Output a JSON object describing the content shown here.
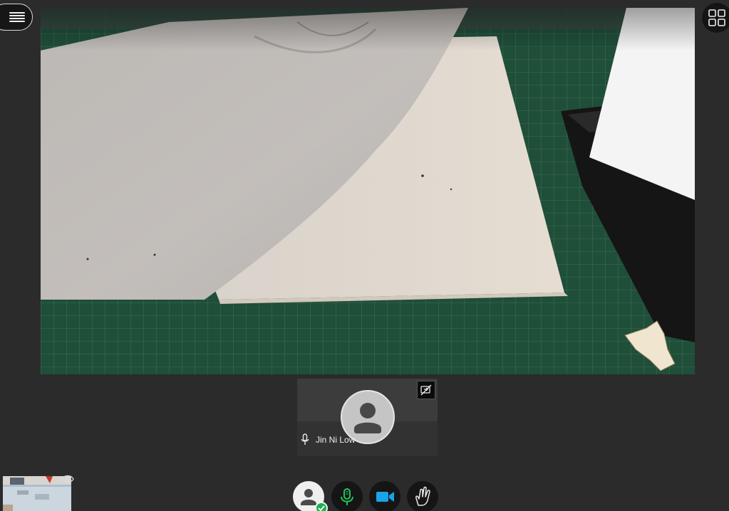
{
  "app": {
    "theme_background": "#2b2b2b",
    "accent_green": "#18b24a",
    "accent_blue": "#1aa3e8"
  },
  "toolbar": {
    "menu_icon": "hamburger-menu-icon",
    "grid_view_icon": "grid-view-icon"
  },
  "main_video": {
    "content_icon": "camera-feed"
  },
  "participant": {
    "name": "Jin Ni Low",
    "avatar_icon": "user-silhouette-icon",
    "mic_icon": "microphone-icon",
    "pin_icon": "pin-off-icon"
  },
  "self_view": {
    "eye_icon": "eye-icon"
  },
  "controls": {
    "status_icon": "user-status-icon",
    "status_badge_icon": "check-icon",
    "mic_icon": "microphone-icon",
    "camera_icon": "video-camera-icon",
    "raise_hand_icon": "raise-hand-icon"
  }
}
